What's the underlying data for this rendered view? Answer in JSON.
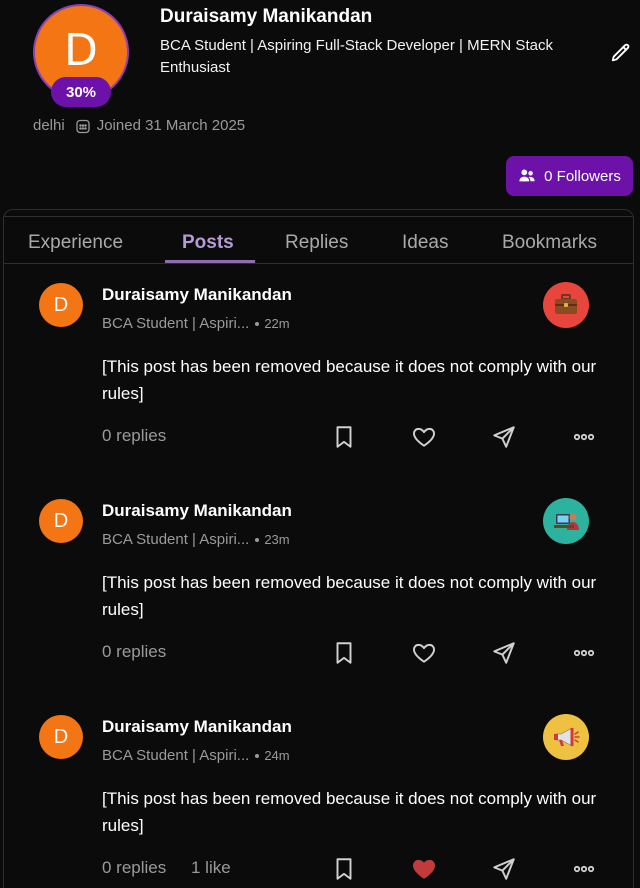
{
  "profile": {
    "avatar_letter": "D",
    "progress": "30%",
    "name": "Duraisamy Manikandan",
    "bio": "BCA Student | Aspiring Full-Stack Developer | MERN Stack Enthusiast",
    "location": "delhi",
    "joined": "Joined 31 March 2025",
    "followers_label": "0 Followers",
    "accent_color": "#6d12a8",
    "avatar_color": "#f47514"
  },
  "tabs": [
    {
      "label": "Experience",
      "active": false
    },
    {
      "label": "Posts",
      "active": true
    },
    {
      "label": "Replies",
      "active": false
    },
    {
      "label": "Ideas",
      "active": false
    },
    {
      "label": "Bookmarks",
      "active": false
    }
  ],
  "posts": [
    {
      "avatar_letter": "D",
      "author": "Duraisamy Manikandan",
      "subtitle": "BCA Student | Aspiri...",
      "time": "22m",
      "badge_icon": "briefcase-icon",
      "content": "[This post has been removed because it does not comply with our rules]",
      "replies": "0 replies",
      "likes": "",
      "liked": false
    },
    {
      "avatar_letter": "D",
      "author": "Duraisamy Manikandan",
      "subtitle": "BCA Student | Aspiri...",
      "time": "23m",
      "badge_icon": "developer-desk-icon",
      "content": "[This post has been removed because it does not comply with our rules]",
      "replies": "0 replies",
      "likes": "",
      "liked": false
    },
    {
      "avatar_letter": "D",
      "author": "Duraisamy Manikandan",
      "subtitle": "BCA Student | Aspiri...",
      "time": "24m",
      "badge_icon": "megaphone-icon",
      "content": "[This post has been removed because it does not comply with our rules]",
      "replies": "0 replies",
      "likes": "1 like",
      "liked": true
    }
  ]
}
